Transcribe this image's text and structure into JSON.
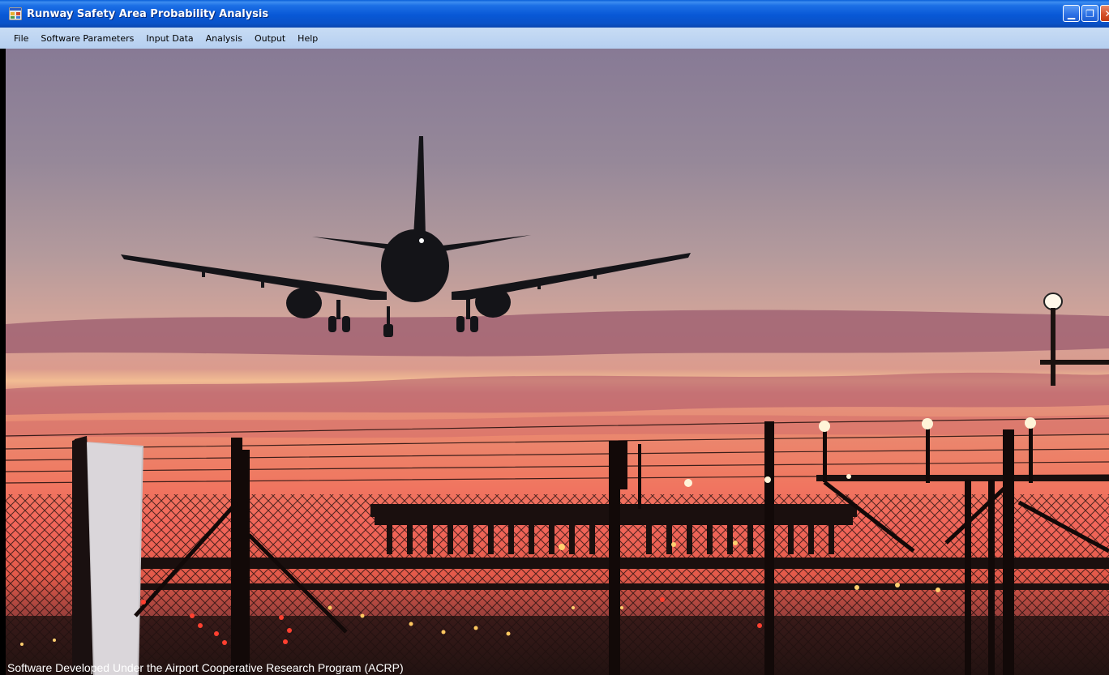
{
  "window": {
    "title": "Runway Safety Area Probability Analysis",
    "icon": "app-window-icon",
    "controls": [
      {
        "name": "minimize-button",
        "glyph": "▁"
      },
      {
        "name": "restore-button",
        "glyph": "❐"
      },
      {
        "name": "close-button",
        "glyph": "✕"
      }
    ]
  },
  "menu": {
    "items": [
      {
        "label": "File"
      },
      {
        "label": "Software Parameters"
      },
      {
        "label": "Input Data"
      },
      {
        "label": "Analysis"
      },
      {
        "label": "Output"
      },
      {
        "label": "Help"
      }
    ]
  },
  "main": {
    "footer": "Software Developed Under the Airport Cooperative Research Program (ACRP)"
  },
  "colors": {
    "titlebar": "#0858d6",
    "menubar": "#c8dcf4",
    "sky_top": "#887a94",
    "sunset": "#f0605a"
  }
}
